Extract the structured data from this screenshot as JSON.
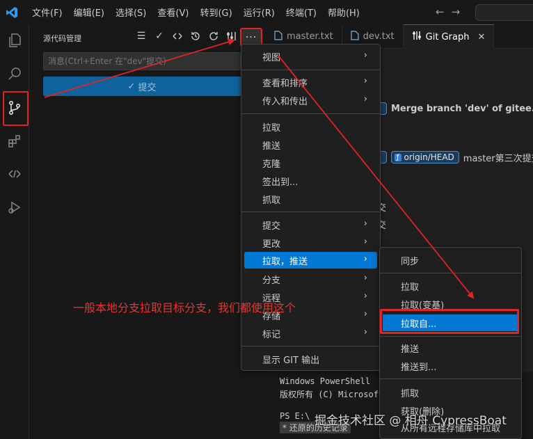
{
  "menubar": {
    "items": [
      "文件(F)",
      "编辑(E)",
      "选择(S)",
      "查看(V)",
      "转到(G)",
      "运行(R)",
      "终端(T)",
      "帮助(H)"
    ]
  },
  "sidebar": {
    "title": "源代码管理",
    "message_placeholder": "消息(Ctrl+Enter 在\"dev\"提交)",
    "commit_label": "提交",
    "more_label": "···"
  },
  "tabs": [
    {
      "label": "master.txt"
    },
    {
      "label": "dev.txt"
    },
    {
      "label": "Git Graph"
    }
  ],
  "graph": {
    "row1_text": "Merge branch 'dev' of gitee.com:",
    "row2_badge": "origin/HEAD",
    "row2_text": "master第三次提交",
    "frag1": "交",
    "frag2": "交"
  },
  "menu": {
    "items": {
      "view": "视图",
      "view_sort": "查看和排序",
      "in_out": "传入和传出",
      "pull": "拉取",
      "push": "推送",
      "clone": "克隆",
      "checkout": "签出到...",
      "fetch": "抓取",
      "commit": "提交",
      "changes": "更改",
      "pull_push": "拉取，推送",
      "branch": "分支",
      "remote": "远程",
      "stash": "存储",
      "tags": "标记",
      "show_git_output": "显示 GIT 输出"
    }
  },
  "submenu": {
    "items": {
      "sync": "同步",
      "pull": "拉取",
      "pull_rebase": "拉取(变基)",
      "pull_from": "拉取自...",
      "push": "推送",
      "push_to": "推送到...",
      "fetch": "抓取",
      "fetch_prune": "获取(删除)",
      "fetch_all": "从所有远程存储库中拉取"
    }
  },
  "terminal": {
    "line1": "Windows PowerShell",
    "line2": "版权所有 (C) Microsoft",
    "line3": "PS E:\\",
    "history": "还原的历史记录"
  },
  "annotation": "一般本地分支拉取目标分支，我们都使用这个",
  "watermark": "掘金技术社区 @ 相舟 CypressBoat",
  "colors": {
    "accent": "#0078d4",
    "annotation_red": "#e02424"
  }
}
